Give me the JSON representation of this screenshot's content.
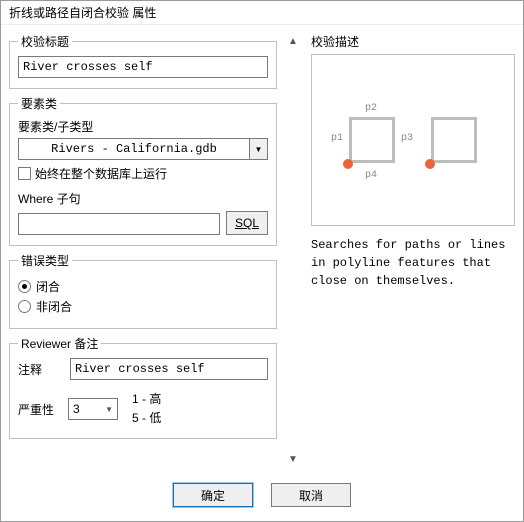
{
  "dialog": {
    "title": "折线或路径自闭合校验 属性"
  },
  "check_title": {
    "legend": "校验标题",
    "value": "River crosses self"
  },
  "feature_class": {
    "legend": "要素类",
    "sub_label": "要素类/子类型",
    "dropdown_value": "Rivers - California.gdb",
    "always_run_label": "始终在整个数据库上运行",
    "where_label": "Where 子句",
    "where_value": "",
    "sql_button": "SQL"
  },
  "error_type": {
    "legend": "错误类型",
    "closed_label": "闭合",
    "nonclosed_label": "非闭合"
  },
  "reviewer": {
    "legend": "Reviewer 备注",
    "note_label": "注释",
    "note_value": "River crosses self",
    "severity_label": "严重性",
    "severity_value": "3",
    "legend_high": "1 - 高",
    "legend_low": "5 - 低"
  },
  "description": {
    "legend": "校验描述",
    "p1": "p1",
    "p2": "p2",
    "p3": "p3",
    "p4": "p4",
    "text": "Searches for paths or lines in polyline features that close on themselves."
  },
  "buttons": {
    "ok": "确定",
    "cancel": "取消"
  }
}
